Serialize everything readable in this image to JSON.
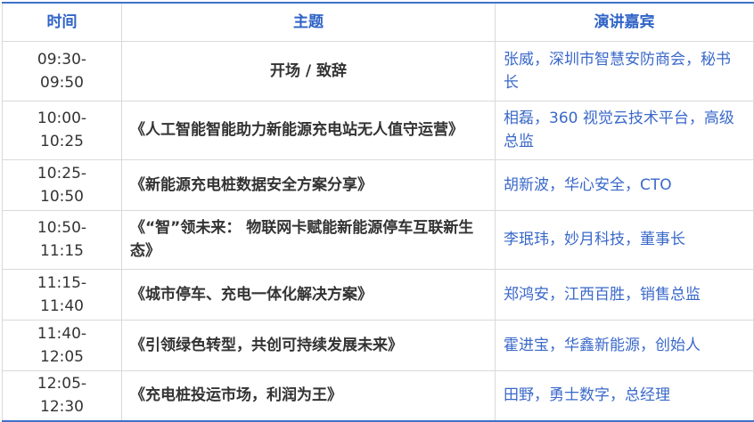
{
  "header": {
    "time": "时间",
    "topic": "主题",
    "speaker": "演讲嘉宾"
  },
  "rows": [
    {
      "time": "09:30-\n09:50",
      "topic": "开场 / 致辞",
      "speaker": "张威，深圳市智慧安防商会，秘书长"
    },
    {
      "time": "10:00-\n10:25",
      "topic": "《人工智能智能助力新能源充电站无人值守运营》",
      "speaker": "相磊，360 视觉云技术平台，高级总监"
    },
    {
      "time": "10:25-\n10:50",
      "topic": "《新能源充电桩数据安全方案分享》",
      "speaker": "胡新波，华心安全，CTO"
    },
    {
      "time": "10:50-\n11:15",
      "topic": "《“智”领未来： 物联网卡赋能新能源停车互联新生态》",
      "speaker": "李珉玮，妙月科技，董事长"
    },
    {
      "time": "11:15-\n11:40",
      "topic": "《城市停车、充电一体化解决方案》",
      "speaker": "郑鸿安，江西百胜，销售总监"
    },
    {
      "time": "11:40-\n12:05",
      "topic": "《引领绿色转型，共创可持续发展未来》",
      "speaker": "霍进宝，华鑫新能源，创始人"
    },
    {
      "time": "12:05-\n12:30",
      "topic": "《充电桩投运市场，利润为王》",
      "speaker": "田野，勇士数字，总经理"
    }
  ]
}
